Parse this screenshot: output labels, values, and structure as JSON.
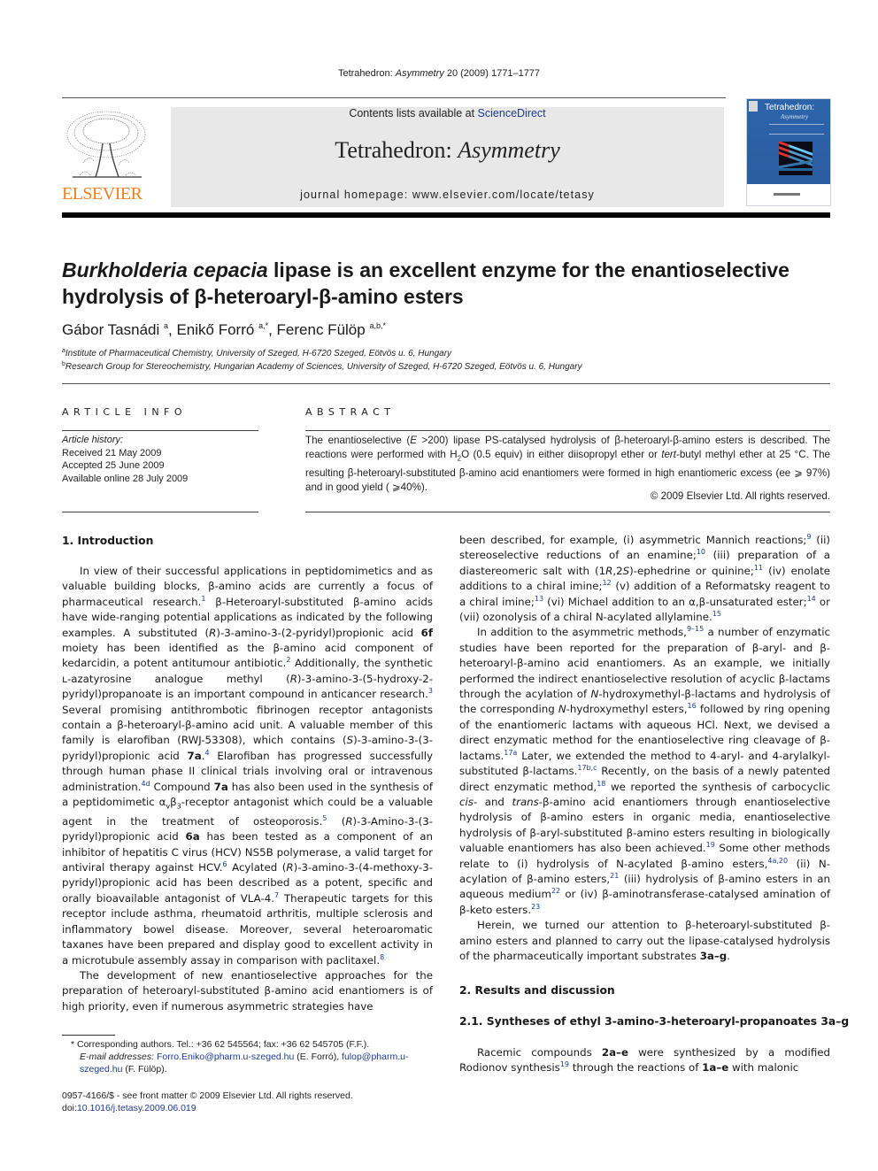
{
  "header": {
    "citation_journal_prefix": "Tetrahedron: ",
    "citation_journal_italic": "Asymmetry",
    "citation_rest": " 20 (2009) 1771–1777",
    "contents_prefix": "Contents lists available at ",
    "contents_link": "ScienceDirect",
    "journal_name_prefix": "Tetrahedron: ",
    "journal_name_italic": "Asymmetry",
    "homepage": "journal homepage: www.elsevier.com/locate/tetasy",
    "publisher_logo_text": "ELSEVIER",
    "cover_title": "Tetrahedron:",
    "cover_subtitle": "Asymmetry",
    "colors": {
      "elsevier_orange": "#f07f1c",
      "link_blue": "#1f3b8f",
      "banner_gray": "#e8e8e8",
      "cover_blue": "#2c64aa"
    }
  },
  "article": {
    "title_italic": "Burkholderia cepacia",
    "title_rest_line1": " lipase is an excellent enzyme for the enantioselective",
    "title_line2": "hydrolysis of β-heteroaryl-β-amino esters",
    "authors": [
      {
        "name": "Gábor Tasnádi",
        "sup": "a"
      },
      {
        "name": "Enikő Forró",
        "sup": "a,*"
      },
      {
        "name": "Ferenc Fülöp",
        "sup": "a,b,*"
      }
    ],
    "affiliations": [
      {
        "sup": "a",
        "text": "Institute of Pharmaceutical Chemistry, University of Szeged, H-6720 Szeged, Eötvös u. 6, Hungary"
      },
      {
        "sup": "b",
        "text": "Research Group for Stereochemistry, Hungarian Academy of Sciences, University of Szeged, H-6720 Szeged, Eötvös u. 6, Hungary"
      }
    ]
  },
  "article_info": {
    "heading": "ARTICLE INFO",
    "history_label": "Article history:",
    "received": "Received 21 May 2009",
    "accepted": "Accepted 25 June 2009",
    "online": "Available online 28 July 2009"
  },
  "abstract": {
    "heading": "ABSTRACT",
    "s1a": "The enantioselective (",
    "s1E": "E",
    "s1b": " >200) lipase PS-catalysed hydrolysis of β-heteroaryl-β-amino esters is described. The reactions were performed with H",
    "s1sub": "2",
    "s1c": "O (0.5 equiv) in either diisopropyl ether or ",
    "s1tert": "tert",
    "s1d": "-butyl methyl ether at 25 °C. The resulting β-heteroaryl-substituted β-amino acid enantiomers were formed in high enantiomeric excess (ee ⩾ 97%) and in good yield ( ⩾40%).",
    "copyright": "© 2009 Elsevier Ltd. All rights reserved."
  },
  "body": {
    "intro_heading": "1.  Introduction",
    "results_heading": "2.  Results and discussion",
    "sub_heading": "2.1.  Syntheses of ethyl 3-amino-3-heteroaryl-propanoates 3a–g",
    "left_col": [
      "In view of their successful applications in peptidomimetics and as valuable building blocks, β-amino acids are currently a focus of pharmaceutical research.",
      "1",
      " β-Heteroaryl-substituted β-amino acids have wide-ranging potential applications as indicated by the following examples. A substituted (",
      "R",
      ")-3-amino-3-(2-pyridyl)propionic acid ",
      "6f",
      " moiety has been identified as the β-amino acid component of kedarcidin, a potent antitumour antibiotic.",
      "2",
      " Additionally, the synthetic ʟ-azatyrosine analogue methyl (",
      "R",
      ")-3-amino-3-(5-hydroxy-2-pyridyl)propanoate is an important compound in anticancer research.",
      "3",
      " Several promising antithrombotic fibrinogen receptor antagonists contain a β-heteroaryl-β-amino acid unit. A valuable member of this family is elarofiban (RWJ-53308), which contains (",
      "S",
      ")-3-amino-3-(3-pyridyl)propionic acid ",
      "7a",
      ".",
      "4",
      " Elarofiban has progressed successfully through human phase II clinical trials involving oral or intravenous administration.",
      "4d",
      " Compound ",
      "7a",
      " has also been used in the synthesis of a peptidomimetic α",
      "v",
      "β",
      "3",
      "-receptor antagonist which could be a valuable agent in the treatment of osteoporosis.",
      "5",
      " (",
      "R",
      ")-3-Amino-3-(3-pyridyl)propionic acid ",
      "6a",
      " has been tested as a component of an inhibitor of hepatitis C virus (HCV) NS5B polymerase, a valid target for antiviral therapy against HCV.",
      "6",
      " Acylated (",
      "R",
      ")-3-amino-3-(4-methoxy-3-pyridyl)propionic acid has been described as a potent, specific and orally bioavailable antagonist of VLA-4.",
      "7",
      " Therapeutic targets for this receptor include asthma, rheumatoid arthritis, multiple sclerosis and inflammatory bowel disease. Moreover, several heteroaromatic taxanes have been prepared and display good to excellent activity in a microtubule assembly assay in comparison with paclitaxel.",
      "8",
      "The development of new enantioselective approaches for the preparation of heteroaryl-substituted β-amino acid enantiomers is of high priority, even if numerous asymmetric strategies have"
    ],
    "right_col": [
      "been described, for example, (i) asymmetric Mannich reactions;",
      "9",
      " (ii) stereoselective reductions of an enamine;",
      "10",
      " (iii) preparation of a diastereomeric salt with (1",
      "R",
      ",2",
      "S",
      ")-ephedrine or quinine;",
      "11",
      " (iv) enolate additions to a chiral imine;",
      "12",
      " (v) addition of a Reformatsky reagent to a chiral imine;",
      "13",
      " (vi) Michael addition to an α,β-unsaturated ester;",
      "14",
      " or (vii) ozonolysis of a chiral N-acylated allylamine.",
      "15",
      "In addition to the asymmetric methods,",
      "9–15",
      " a number of enzymatic studies have been reported for the preparation of β-aryl- and β-heteroaryl-β-amino acid enantiomers. As an example, we initially performed the indirect enantioselective resolution of acyclic β-lactams through the acylation of ",
      "N",
      "-hydroxymethyl-β-lactams and hydrolysis of the corresponding ",
      "N",
      "-hydroxymethyl esters,",
      "16",
      " followed by ring opening of the enantiomeric lactams with aqueous HCl. Next, we devised a direct enzymatic method for the enantioselective ring cleavage of β-lactams.",
      "17a",
      " Later, we extended the method to 4-aryl- and 4-arylalkyl-substituted β-lactams.",
      "17b,c",
      " Recently, on the basis of a newly patented direct enzymatic method,",
      "18",
      " we reported the synthesis of carbocyclic ",
      "cis",
      "- and ",
      "trans",
      "-β-amino acid enantiomers through enantioselective hydrolysis of β-amino esters in organic media, enantioselective hydrolysis of β-aryl-substituted β-amino esters resulting in biologically valuable enantiomers has also been achieved.",
      "19",
      " Some other methods relate to (i) hydrolysis of N-acylated β-amino esters,",
      "4a,20",
      " (ii) N-acylation of β-amino esters,",
      "21",
      " (iii) hydrolysis of β-amino esters in an aqueous medium",
      "22",
      " or (iv) β-aminotransferase-catalysed amination of β-keto esters.",
      "23",
      "Herein, we turned our attention to β-heteroaryl-substituted β-amino esters and planned to carry out the lipase-catalysed hydrolysis of the pharmaceutically important substrates ",
      "3a–g",
      ".",
      "Racemic compounds ",
      "2a–e",
      " were synthesized by a modified Rodionov synthesis",
      "19",
      " through the reactions of ",
      "1a–e",
      " with malonic"
    ]
  },
  "footnotes": {
    "corresponding": "*  Corresponding authors. Tel.: +36 62 545564; fax: +36 62 545705 (F.F.).",
    "email_label": "E-mail addresses:",
    "email1": "Forro.Eniko@pharm.u-szeged.hu",
    "email1_owner": " (E. Forró), ",
    "email2": "fulop@pharm.u-szeged.hu",
    "email2_owner": " (F. Fülöp).",
    "issn": "0957-4166/$ - see front matter © 2009 Elsevier Ltd. All rights reserved.",
    "doi_label": "doi:",
    "doi": "10.1016/j.tetasy.2009.06.019"
  }
}
